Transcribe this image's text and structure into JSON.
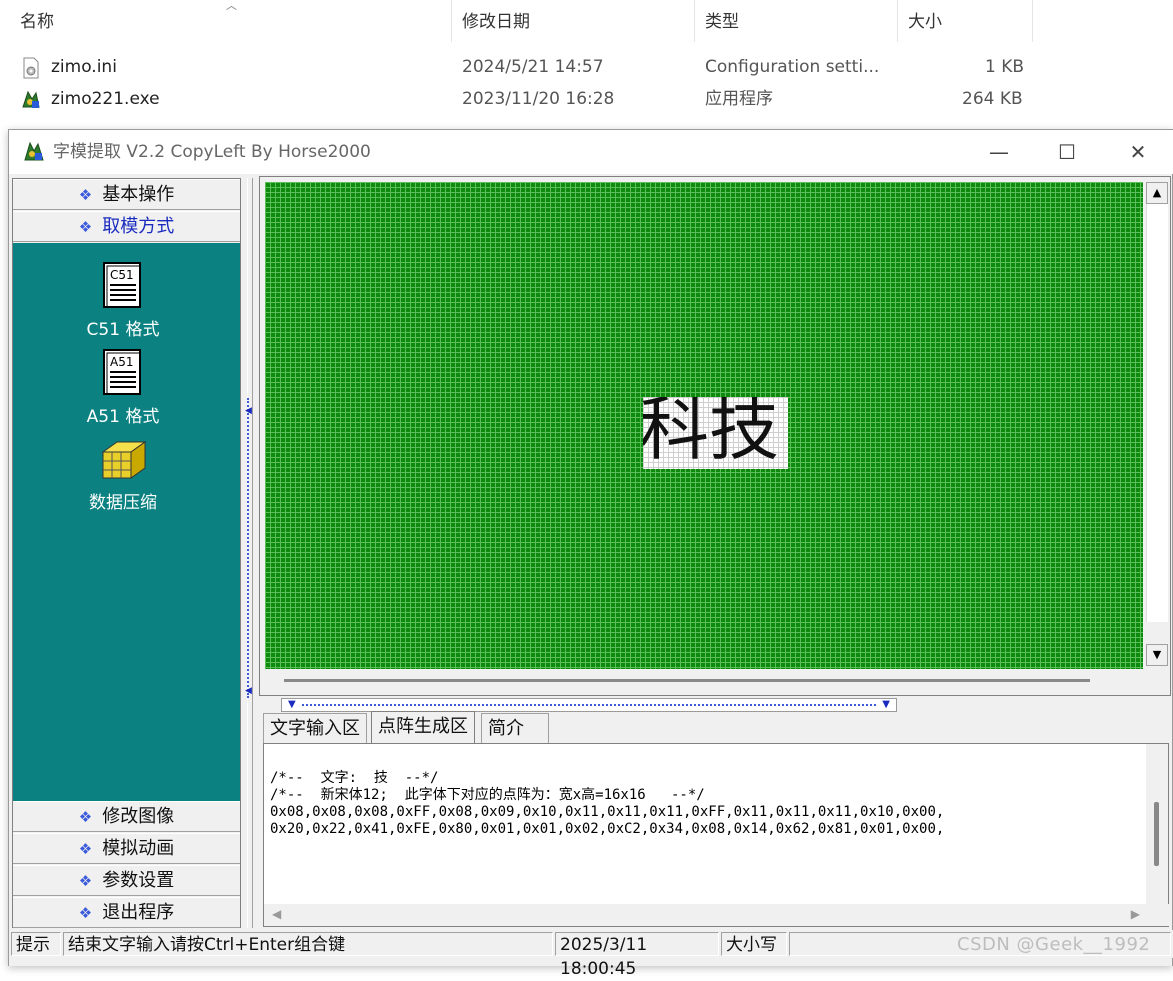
{
  "explorer": {
    "columns": {
      "name": "名称",
      "modified": "修改日期",
      "type": "类型",
      "size": "大小"
    },
    "sort_indicator": "^",
    "files": [
      {
        "name": "zimo.ini",
        "modified": "2024/5/21 14:57",
        "type": "Configuration setti...",
        "size": "1 KB",
        "icon": "config-file-icon"
      },
      {
        "name": "zimo221.exe",
        "modified": "2023/11/20 16:28",
        "type": "应用程序",
        "size": "264 KB",
        "icon": "application-icon"
      }
    ]
  },
  "window": {
    "title": "字模提取 V2.2  CopyLeft By Horse2000",
    "minimize": "—",
    "maximize": "☐",
    "close": "✕"
  },
  "left_panel": {
    "top_buttons": [
      {
        "label": "基本操作",
        "icon": "diamond-icon"
      },
      {
        "label": "取模方式",
        "icon": "diamond-icon"
      }
    ],
    "tools": [
      {
        "label": "C51 格式",
        "icon_text": "C51"
      },
      {
        "label": "A51 格式",
        "icon_text": "A51"
      },
      {
        "label": "数据压缩",
        "icon": "cube-icon"
      }
    ],
    "bottom_buttons": [
      {
        "label": "修改图像"
      },
      {
        "label": "模拟动画"
      },
      {
        "label": "参数设置"
      },
      {
        "label": "退出程序"
      }
    ],
    "bullet": "❖"
  },
  "canvas": {
    "glyph_text": "科技",
    "scroll_up": "▲",
    "scroll_down": "▼"
  },
  "splitter": {
    "left_arrow": "▼",
    "right_arrow": "▼"
  },
  "tabs": [
    {
      "label": "文字输入区"
    },
    {
      "label": "点阵生成区"
    },
    {
      "label": "简介"
    }
  ],
  "output": {
    "lines": [
      "/*--  文字:  技  --*/",
      "/*--  新宋体12;  此字体下对应的点阵为：宽x高=16x16   --*/",
      "0x08,0x08,0x08,0xFF,0x08,0x09,0x10,0x11,0x11,0x11,0xFF,0x11,0x11,0x11,0x10,0x00,",
      "0x20,0x22,0x41,0xFE,0x80,0x01,0x01,0x02,0xC2,0x34,0x08,0x14,0x62,0x81,0x01,0x00,"
    ],
    "scroll_left": "◀",
    "scroll_right": "▶"
  },
  "status": {
    "label": "提示",
    "message": "结束文字输入请按Ctrl+Enter组合键",
    "datetime": "2025/3/11 18:00:45",
    "caps": "大小写"
  },
  "watermark": "CSDN @Geek__1992"
}
